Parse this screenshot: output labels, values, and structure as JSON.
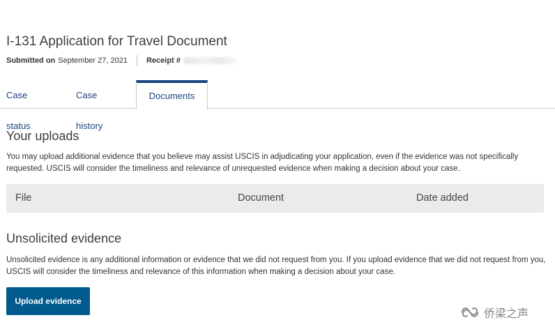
{
  "header": {
    "title": "I-131 Application for Travel Document",
    "submitted_label": "Submitted on",
    "submitted_date": "September 27, 2021",
    "receipt_label": "Receipt #"
  },
  "tabs": [
    {
      "label": "Case status",
      "active": false
    },
    {
      "label": "Case history",
      "active": false
    },
    {
      "label": "Documents",
      "active": true
    }
  ],
  "uploads": {
    "title": "Your uploads",
    "description": "You may upload additional evidence that you believe may assist USCIS in adjudicating your application, even if the evidence was not specifically requested. USCIS will consider the timeliness and relevance of unrequested evidence when making a decision about your case.",
    "columns": [
      "File",
      "Document",
      "Date added"
    ],
    "rows": []
  },
  "unsolicited": {
    "title": "Unsolicited evidence",
    "description": "Unsolicited evidence is any additional information or evidence that we did not request from you. If you upload evidence that we did not request from you, USCIS will consider the timeliness and relevance of this information when making a decision about your case.",
    "button_label": "Upload evidence"
  },
  "watermark": {
    "text": "侨梁之声",
    "icon": "wechat-channel-icon"
  },
  "colors": {
    "accent": "#1a4480",
    "button": "#005a8d",
    "table_header_bg": "#ebebeb"
  }
}
